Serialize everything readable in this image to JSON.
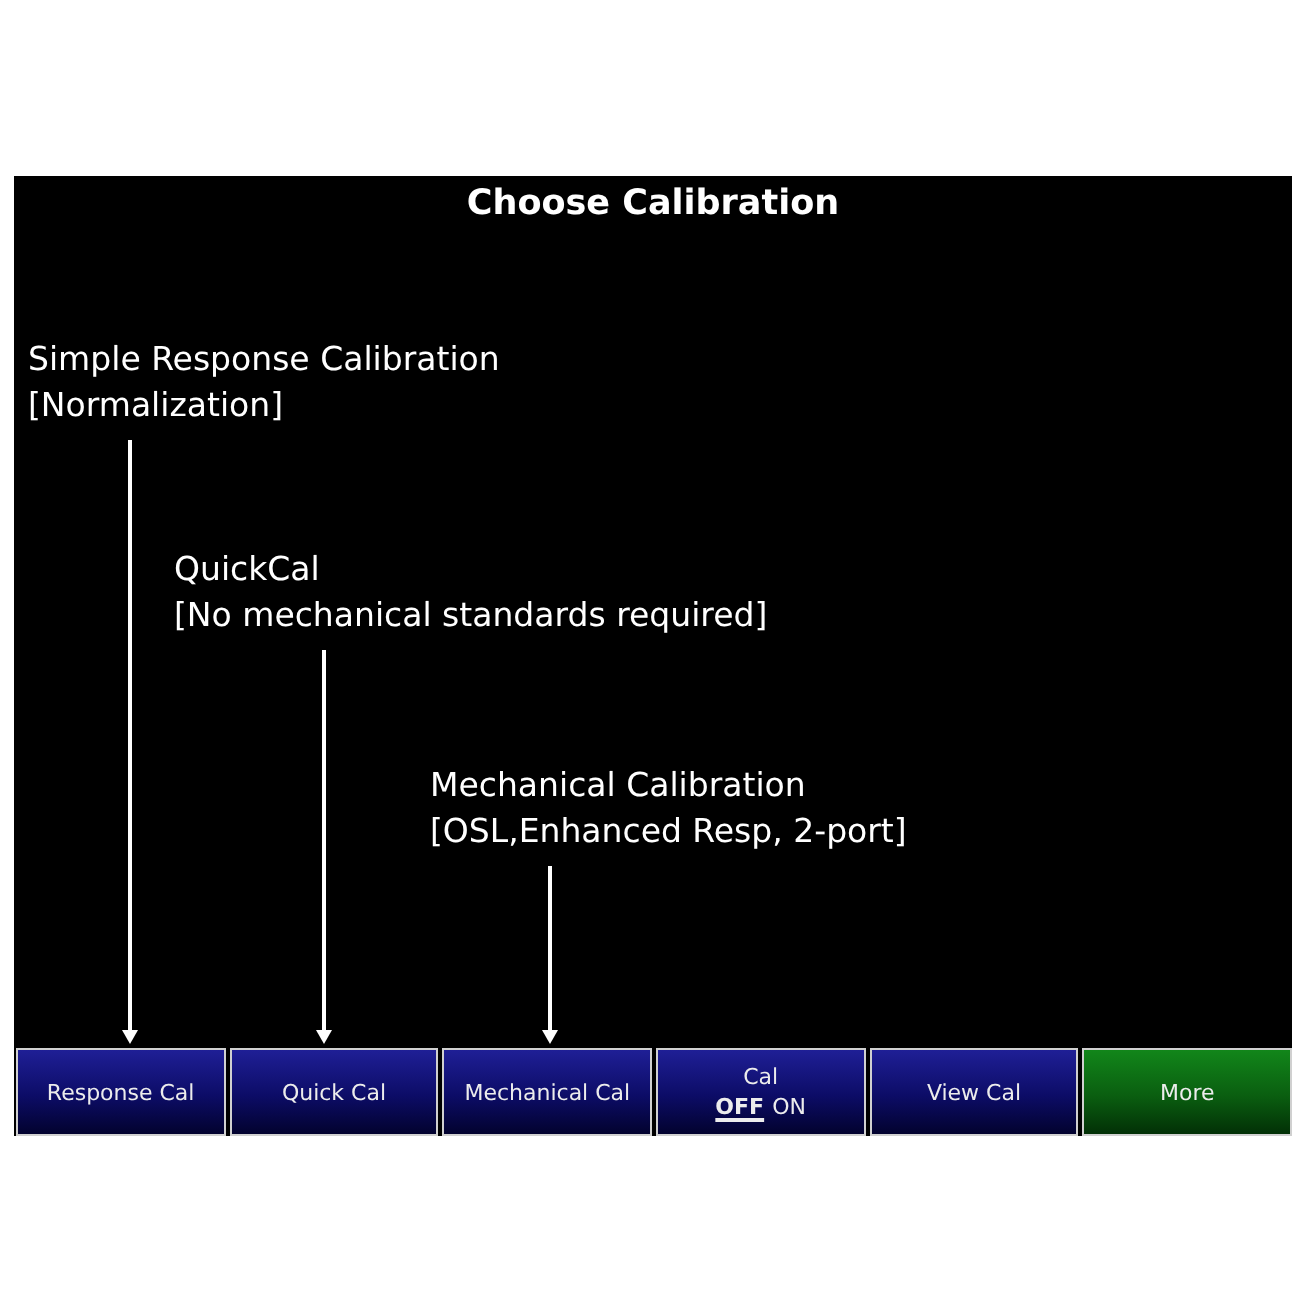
{
  "screen": {
    "title": "Choose Calibration"
  },
  "callouts": [
    {
      "title": "Simple Response Calibration",
      "detail": "[Normalization]"
    },
    {
      "title": "QuickCal",
      "detail": "[No mechanical standards required]"
    },
    {
      "title": "Mechanical Calibration",
      "detail": "[OSL,Enhanced Resp, 2-port]"
    }
  ],
  "softkeys": [
    {
      "kind": "action",
      "label": "Response Cal"
    },
    {
      "kind": "action",
      "label": "Quick Cal"
    },
    {
      "kind": "action",
      "label": "Mechanical Cal"
    },
    {
      "kind": "toggle",
      "label": "Cal",
      "options": [
        {
          "label": "OFF",
          "selected": true
        },
        {
          "label": "ON",
          "selected": false
        }
      ]
    },
    {
      "kind": "action",
      "label": "View Cal"
    },
    {
      "kind": "more",
      "label": "More"
    }
  ]
}
